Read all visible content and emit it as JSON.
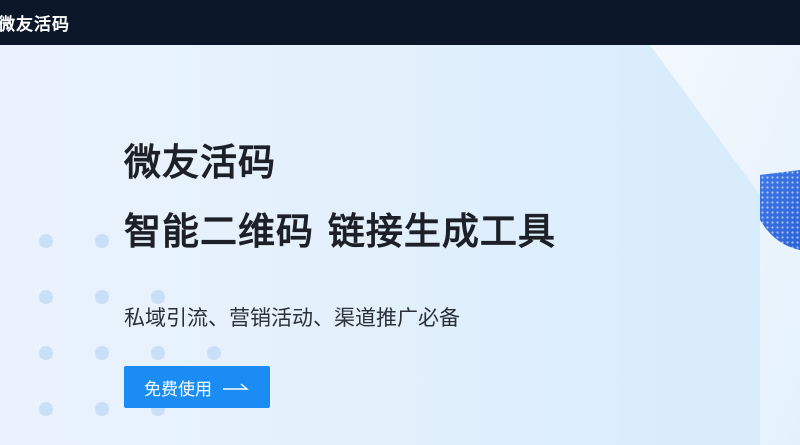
{
  "header": {
    "brand": "微友活码"
  },
  "hero": {
    "title_line1": "微友活码",
    "title_line2": "智能二维码 链接生成工具",
    "subtitle": "私域引流、营销活动、渠道推广必备",
    "cta_label": "免费使用"
  },
  "colors": {
    "topbar": "#0b1628",
    "accent": "#1a8cf3",
    "text": "#1d2026",
    "background": "#e3f0fc"
  },
  "icons": {
    "cta_icon": "arrow-right-icon"
  }
}
